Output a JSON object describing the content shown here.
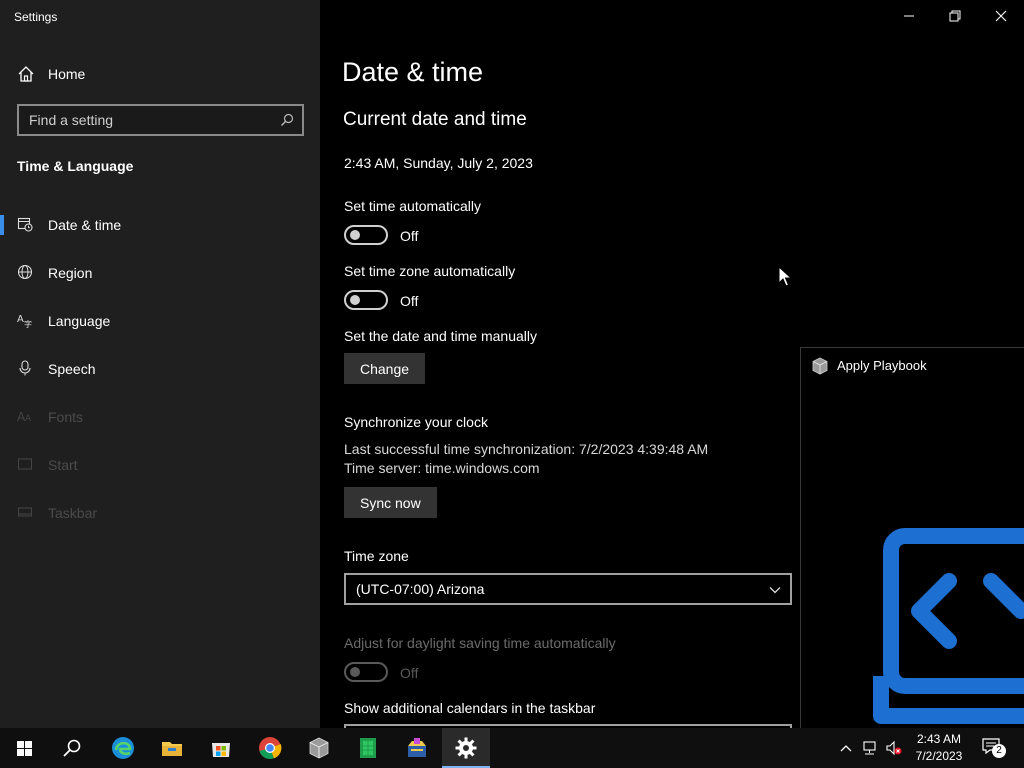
{
  "window": {
    "title": "Settings"
  },
  "sidebar": {
    "home_label": "Home",
    "search_placeholder": "Find a setting",
    "section_heading": "Time & Language",
    "items": [
      {
        "label": "Date & time",
        "icon": "calendar-clock-icon",
        "selected": true
      },
      {
        "label": "Region",
        "icon": "globe-icon"
      },
      {
        "label": "Language",
        "icon": "language-icon"
      },
      {
        "label": "Speech",
        "icon": "microphone-icon"
      },
      {
        "label": "Fonts",
        "icon": "fonts-icon",
        "disabled": true
      },
      {
        "label": "Start",
        "icon": "start-icon",
        "disabled": true
      },
      {
        "label": "Taskbar",
        "icon": "taskbar-icon",
        "disabled": true
      }
    ]
  },
  "main": {
    "page_title": "Date & time",
    "section_title": "Current date and time",
    "current_datetime": "2:43 AM, Sunday, July 2, 2023",
    "set_time_auto": {
      "label": "Set time automatically",
      "state": "Off"
    },
    "set_tz_auto": {
      "label": "Set time zone automatically",
      "state": "Off"
    },
    "manual": {
      "label": "Set the date and time manually",
      "button": "Change"
    },
    "sync": {
      "title": "Synchronize your clock",
      "last_sync": "Last successful time synchronization: 7/2/2023 4:39:48 AM",
      "server": "Time server: time.windows.com",
      "button": "Sync now"
    },
    "timezone": {
      "label": "Time zone",
      "value": "(UTC-07:00) Arizona"
    },
    "dst": {
      "label": "Adjust for daylight saving time automatically",
      "state": "Off"
    },
    "calendars_label": "Show additional calendars in the taskbar"
  },
  "playbook_window": {
    "title": "Apply Playbook"
  },
  "taskbar": {
    "apps": [
      "start-icon",
      "search-icon",
      "edge-icon",
      "file-explorer-icon",
      "store-icon",
      "chrome-icon",
      "package-icon",
      "spreadsheet-icon",
      "installer-icon",
      "settings-icon"
    ],
    "time": "2:43 AM",
    "date": "7/2/2023",
    "notification_count": "2"
  },
  "colors": {
    "accent": "#3a8eea",
    "sidebar_bg": "#1f1f1f",
    "main_bg": "#000000",
    "playbook_blue": "#1d6fd1"
  }
}
